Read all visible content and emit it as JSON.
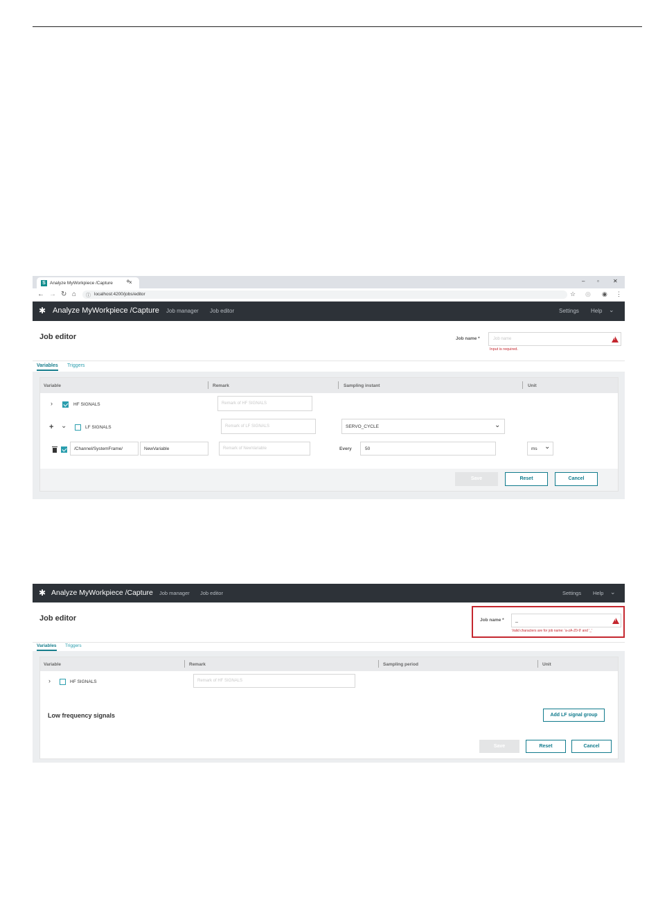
{
  "shot1": {
    "browser": {
      "tab_title": "Analyze MyWorkpiece /Capture",
      "favicon_letter": "S",
      "url": "localhost:4200/jobs/editor",
      "new_tab": "+",
      "close": "×",
      "win_min": "–",
      "win_restore": "▫",
      "win_close": "✕"
    },
    "app": {
      "title": "Analyze MyWorkpiece /Capture",
      "nav": [
        "Job manager",
        "Job editor"
      ],
      "settings": "Settings",
      "help": "Help"
    },
    "page": {
      "title": "Job editor",
      "job_name_label": "Job name *",
      "job_name_placeholder": "Job name",
      "error": "Input is required."
    },
    "tabs": [
      "Variables",
      "Triggers"
    ],
    "columns": [
      "Variable",
      "Remark",
      "Sampling instant",
      "Unit"
    ],
    "rows": [
      {
        "label": "HF SIGNALS",
        "remark_placeholder": "Remark of HF SIGNALS"
      },
      {
        "label": "LF SIGNALS",
        "remark_placeholder": "Remark of LF SIGNALS",
        "sampling": "SERVO_CYCLE"
      },
      {
        "path": "/Channel/SystemFrame/",
        "name": "NewVariable",
        "remark_placeholder": "Remark of NewVariable",
        "every_label": "Every",
        "every_value": "50",
        "unit": "ms"
      }
    ],
    "buttons": {
      "save": "Save",
      "reset": "Reset",
      "cancel": "Cancel"
    }
  },
  "shot2": {
    "app": {
      "title": "Analyze MyWorkpiece /Capture",
      "nav": [
        "Job manager",
        "Job editor"
      ],
      "settings": "Settings",
      "help": "Help"
    },
    "page": {
      "title": "Job editor",
      "job_name_label": "Job name *",
      "job_name_value": "_",
      "error": "Valid characters are for job name: 'a-zA-Z0-9' and '_'"
    },
    "tabs": [
      "Variables",
      "Triggers"
    ],
    "columns": [
      "Variable",
      "Remark",
      "Sampling period",
      "Unit"
    ],
    "rows": [
      {
        "label": "HF SIGNALS",
        "remark_placeholder": "Remark of HF SIGNALS"
      }
    ],
    "lf_section_title": "Low frequency signals",
    "add_lf_button": "Add LF signal group",
    "buttons": {
      "save": "Save",
      "reset": "Reset",
      "cancel": "Cancel"
    }
  }
}
